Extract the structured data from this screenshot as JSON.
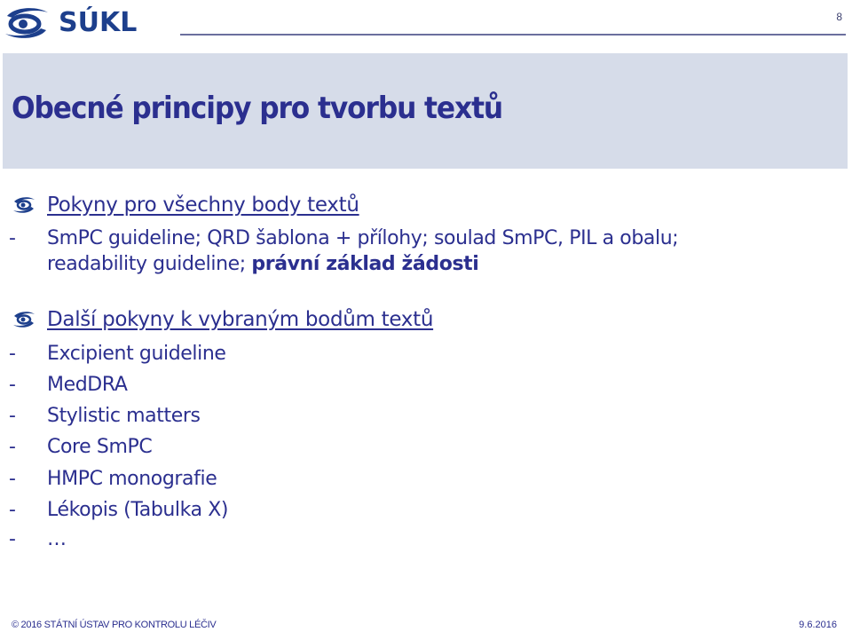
{
  "header": {
    "logo_text": "SÚKL",
    "page_number": "8"
  },
  "slide": {
    "title": "Obecné principy pro tvorbu textů",
    "sections": [
      {
        "heading": "Pokyny pro všechny body textů",
        "lines": [
          {
            "dash": "-",
            "text": "SmPC guideline; QRD šablona + přílohy; soulad SmPC, PIL a obalu;"
          },
          {
            "dash": "",
            "text": "readability guideline; ",
            "bold_text": "právní základ žádosti"
          }
        ]
      },
      {
        "heading": "Další pokyny k vybraným bodům textů",
        "lines": [
          {
            "dash": "-",
            "text": "Excipient guideline"
          },
          {
            "dash": "-",
            "text": "MedDRA"
          },
          {
            "dash": "-",
            "text": "Stylistic matters"
          },
          {
            "dash": "-",
            "text": "Core SmPC"
          },
          {
            "dash": "-",
            "text": "HMPC monografie"
          },
          {
            "dash": "-",
            "text": "Lékopis (Tabulka X)"
          },
          {
            "dash": "-",
            "text": "…"
          }
        ]
      }
    ]
  },
  "footer": {
    "copyright": "© 2016 STÁTNÍ ÚSTAV PRO KONTROLU LÉČIV",
    "date": "9.6.2016"
  },
  "colors": {
    "text": "#2b2f8f",
    "title_band": "#d6dce9",
    "logo": "#1d3f8c"
  }
}
